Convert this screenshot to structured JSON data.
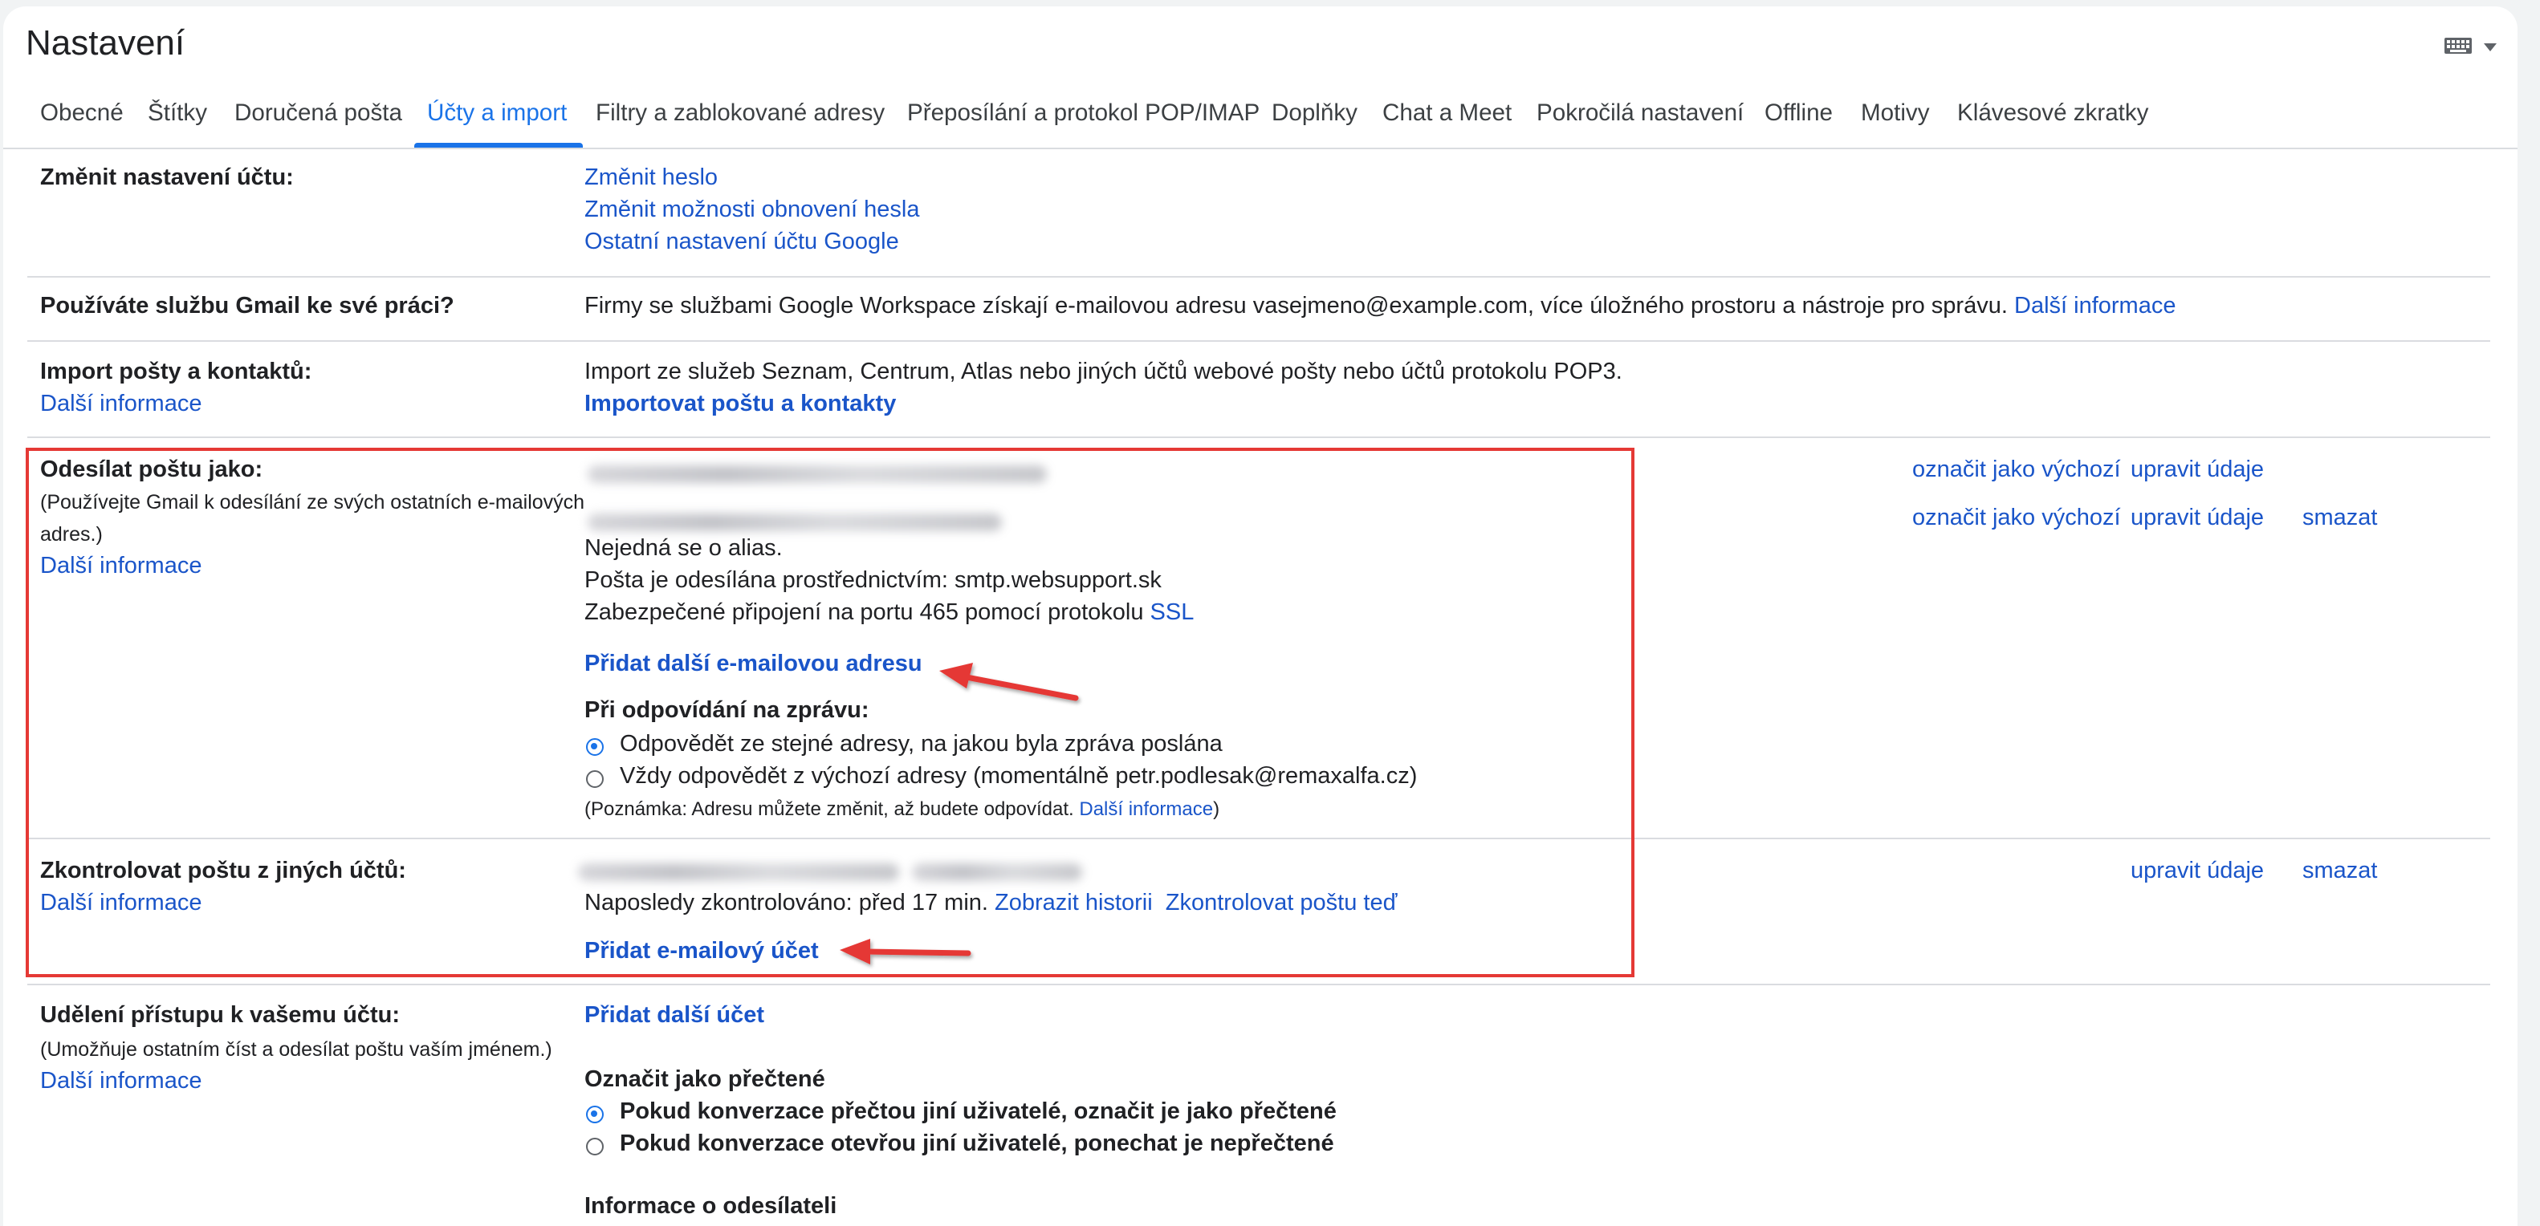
{
  "header": {
    "title": "Nastavení",
    "input_tools_icon": "keyboard-icon"
  },
  "tabs": [
    {
      "label": "Obecné"
    },
    {
      "label": "Štítky"
    },
    {
      "label": "Doručená pošta"
    },
    {
      "label": "Účty a import",
      "active": true
    },
    {
      "label": "Filtry a zablokované adresy"
    },
    {
      "label": "Přeposílání a protokol POP/IMAP"
    },
    {
      "label": "Doplňky"
    },
    {
      "label": "Chat a Meet"
    },
    {
      "label": "Pokročilá nastavení"
    },
    {
      "label": "Offline"
    },
    {
      "label": "Motivy"
    },
    {
      "label": "Klávesové zkratky"
    }
  ],
  "change_account": {
    "label": "Změnit nastavení účtu:",
    "links": [
      "Změnit heslo",
      "Změnit možnosti obnovení hesla",
      "Ostatní nastavení účtu Google"
    ]
  },
  "workspace": {
    "label": "Používáte službu Gmail ke své práci?",
    "text": "Firmy se službami Google Workspace získají e-mailovou adresu vasejmeno@example.com, více úložného prostoru a nástroje pro správu.",
    "link": "Další informace"
  },
  "import": {
    "label": "Import pošty a kontaktů:",
    "more_info": "Další informace",
    "text": "Import ze služeb Seznam, Centrum, Atlas nebo jiných účtů webové pošty nebo účtů protokolu POP3.",
    "action": "Importovat poštu a kontakty"
  },
  "send_as": {
    "label": "Odesílat poštu jako:",
    "note_line1": "(Používejte Gmail k odesílání ze svých ostatních e-mailových",
    "note_line2": "adres.)",
    "more_info": "Další informace",
    "alias_note": "Nejedná se o alias.",
    "smtp_text": "Pošta je odesílána prostřednictvím: smtp.websupport.sk",
    "secure_text": "Zabezpečené připojení na portu 465 pomocí protokolu",
    "secure_link": "SSL",
    "add_address": "Přidat další e-mailovou adresu",
    "reply_heading": "Při odpovídání na zprávu:",
    "reply_option1": "Odpovědět ze stejné adresy, na jakou byla zpráva poslána",
    "reply_option2": "Vždy odpovědět z výchozí adresy (momentálně petr.podlesak@remaxalfa.cz)",
    "reply_option1_selected": true,
    "note_prefix": "(Poznámka: Adresu můžete změnit, až budete odpovídat.",
    "note_link": "Další informace",
    "note_suffix": ")",
    "row_actions": {
      "make_default": "označit jako výchozí",
      "edit": "upravit údaje",
      "delete": "smazat"
    }
  },
  "check_mail": {
    "label": "Zkontrolovat poštu z jiných účtů:",
    "more_info": "Další informace",
    "last_checked": "Naposledy zkontrolováno: před 17 min.",
    "view_history": "Zobrazit historii",
    "check_now": "Zkontrolovat poštu teď",
    "add_account": "Přidat e-mailový účet",
    "edit": "upravit údaje",
    "delete": "smazat"
  },
  "grant_access": {
    "label": "Udělení přístupu k vašemu účtu:",
    "note": "(Umožňuje ostatním číst a odesílat poštu vaším jménem.)",
    "more_info": "Další informace",
    "add_account": "Přidat další účet",
    "mark_read_heading": "Označit jako přečtené",
    "option1": "Pokud konverzace přečtou jiní uživatelé, označit je jako přečtené",
    "option2": "Pokud konverzace otevřou jiní uživatelé, ponechat je nepřečtené",
    "option1_selected": true,
    "sender_info_heading": "Informace o odesílateli"
  },
  "colors": {
    "accent": "#1a73e8",
    "link": "#1a55c9",
    "highlight_box": "#e53935",
    "annotation_arrow": "#e53935"
  }
}
